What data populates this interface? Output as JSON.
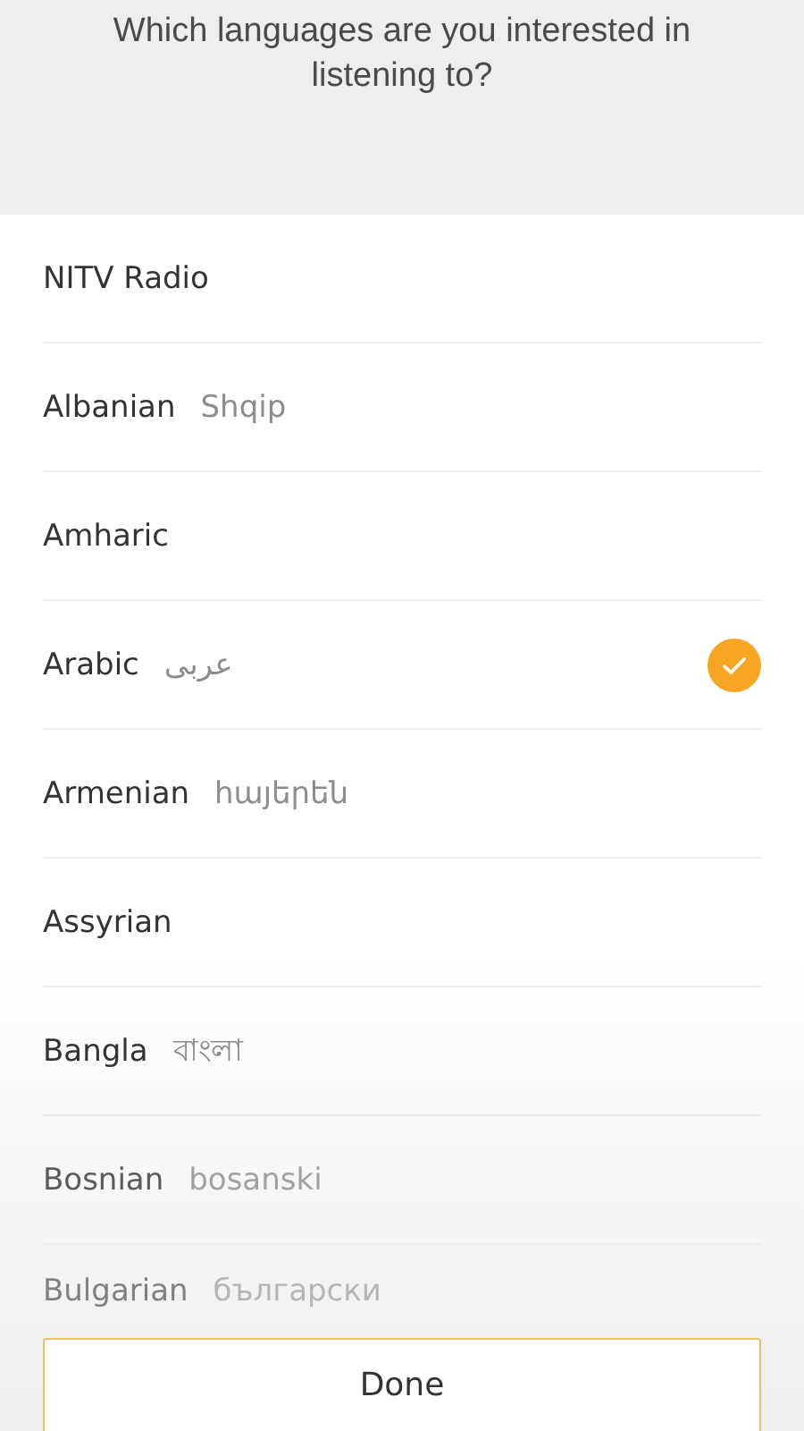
{
  "header": {
    "title": "Which languages are you interested in listening to?"
  },
  "languages": [
    {
      "name": "NITV Radio",
      "selected": false
    },
    {
      "name": "Albanian",
      "native": "Shqip",
      "selected": false
    },
    {
      "name": "Amharic",
      "selected": false
    },
    {
      "name": "Arabic",
      "native": "عربى",
      "selected": true
    },
    {
      "name": "Armenian",
      "native": "հայերեն",
      "selected": false
    },
    {
      "name": "Assyrian",
      "selected": false
    },
    {
      "name": "Bangla",
      "native": "বাংলা",
      "selected": false
    },
    {
      "name": "Bosnian",
      "native": "bosanski",
      "selected": false
    },
    {
      "name": "Bulgarian",
      "native": "български",
      "selected": false
    }
  ],
  "done_button": "Done"
}
